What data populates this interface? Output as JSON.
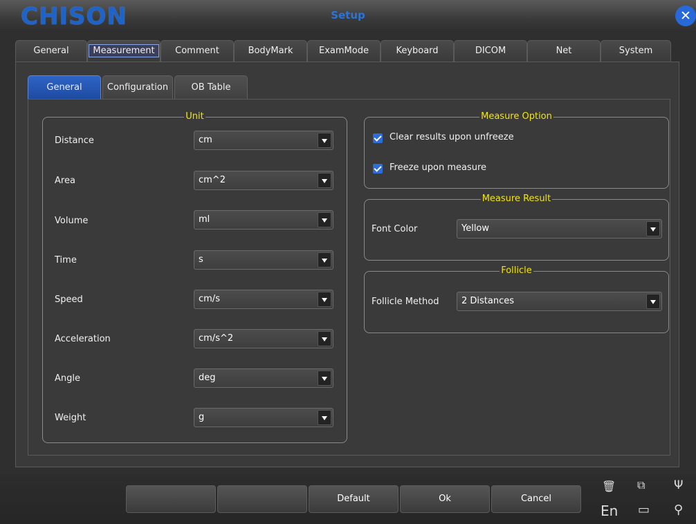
{
  "window": {
    "logo": "CHISON",
    "title": "Setup"
  },
  "main_tabs": [
    {
      "label": "General"
    },
    {
      "label": "Measurement"
    },
    {
      "label": "Comment"
    },
    {
      "label": "BodyMark"
    },
    {
      "label": "ExamMode"
    },
    {
      "label": "Keyboard"
    },
    {
      "label": "DICOM"
    },
    {
      "label": "Net"
    },
    {
      "label": "System"
    }
  ],
  "active_main_tab": "Measurement",
  "sub_tabs": [
    {
      "label": "General"
    },
    {
      "label": "Configuration"
    },
    {
      "label": "OB Table"
    }
  ],
  "active_sub_tab": "General",
  "unit_group": {
    "title": "Unit",
    "rows": [
      {
        "label": "Distance",
        "value": "cm"
      },
      {
        "label": "Area",
        "value": "cm^2"
      },
      {
        "label": "Volume",
        "value": "ml"
      },
      {
        "label": "Time",
        "value": "s"
      },
      {
        "label": "Speed",
        "value": "cm/s"
      },
      {
        "label": "Acceleration",
        "value": "cm/s^2"
      },
      {
        "label": "Angle",
        "value": "deg"
      },
      {
        "label": "Weight",
        "value": "g"
      }
    ]
  },
  "measure_option": {
    "title": "Measure Option",
    "options": [
      {
        "label": "Clear results upon unfreeze",
        "checked": true
      },
      {
        "label": "Freeze upon measure",
        "checked": true
      }
    ]
  },
  "measure_result": {
    "title": "Measure Result",
    "font_color_label": "Font Color",
    "font_color_value": "Yellow"
  },
  "follicle": {
    "title": "Follicle",
    "method_label": "Follicle Method",
    "method_value": "2 Distances"
  },
  "buttons": {
    "blank1": "",
    "blank2": "",
    "default": "Default",
    "ok": "Ok",
    "cancel": "Cancel"
  },
  "status": {
    "language": "En"
  },
  "colors": {
    "accent": "#2c6ad6",
    "legend": "#f2e50c",
    "background": "#3a3a3a"
  }
}
